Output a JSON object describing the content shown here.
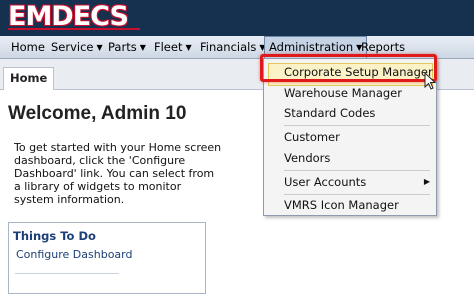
{
  "app": {
    "logo_text": "EMDECS"
  },
  "nav": {
    "items": [
      {
        "label": "Home",
        "has_menu": false
      },
      {
        "label": "Service",
        "has_menu": true
      },
      {
        "label": "Parts",
        "has_menu": true
      },
      {
        "label": "Fleet",
        "has_menu": true
      },
      {
        "label": "Financials",
        "has_menu": true
      },
      {
        "label": "Administration",
        "has_menu": true,
        "active": true
      },
      {
        "label": "Reports",
        "has_menu": false
      }
    ],
    "caret": "▼"
  },
  "tabs": [
    {
      "label": "Home",
      "active": true
    }
  ],
  "main": {
    "welcome": "Welcome, Admin 10",
    "intro": "To get started with your Home screen dashboard, click the 'Configure Dashboard' link. You can select from a library of widgets to monitor system information.",
    "panel": {
      "title": "Things To Do",
      "link": "Configure Dashboard"
    }
  },
  "admin_menu": {
    "items": [
      {
        "label": "Corporate Setup Manager",
        "highlighted": true
      },
      {
        "label": "Warehouse Manager"
      },
      {
        "label": "Standard Codes"
      },
      {
        "label": "Customer"
      },
      {
        "label": "Vendors"
      },
      {
        "label": "User Accounts",
        "submenu": true
      },
      {
        "label": "VMRS Icon Manager"
      }
    ],
    "submenu_arrow": "▶"
  },
  "colors": {
    "header_bg": "#16314f",
    "logo_red": "#c8102e",
    "callout_red": "#e0191a",
    "link_blue": "#1d3f77",
    "highlight_bg": "#fbf3c7"
  },
  "icons": {
    "cursor": "mouse-pointer-icon"
  }
}
